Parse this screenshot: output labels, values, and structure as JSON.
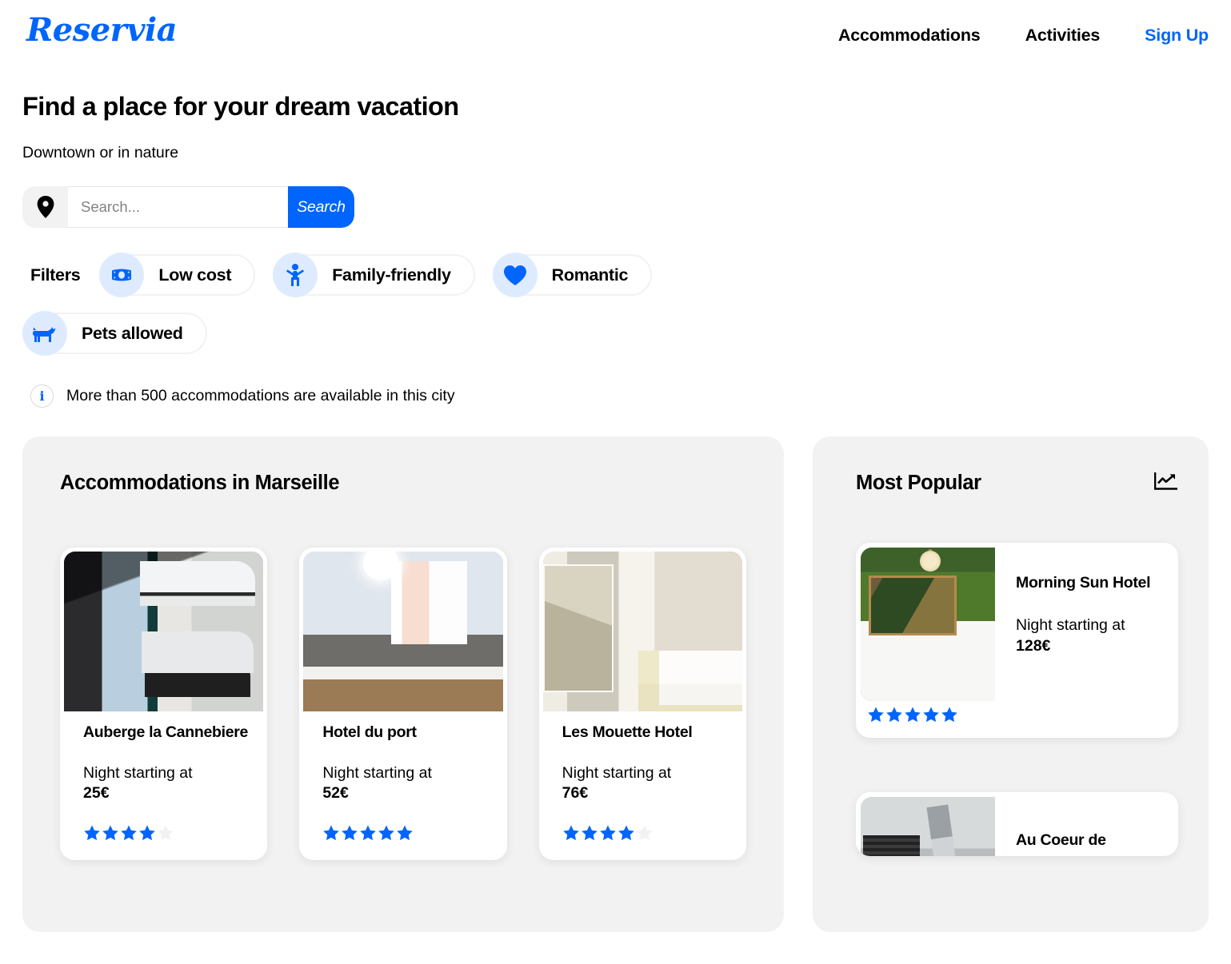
{
  "brand": {
    "name": "Reservia",
    "accent": "#0065FC",
    "accent_light": "#deebff",
    "panel_bg": "#f2f2f2",
    "star_empty": "#f2f2f2"
  },
  "nav": {
    "items": [
      {
        "label": "Accommodations",
        "name": "nav-accommodations"
      },
      {
        "label": "Activities",
        "name": "nav-activities"
      },
      {
        "label": "Sign Up",
        "name": "nav-signup"
      }
    ]
  },
  "hero": {
    "title": "Find a place for your dream vacation",
    "subtitle": "Downtown or in nature"
  },
  "search": {
    "pin_icon": "map-pin-icon",
    "placeholder": "Search...",
    "value": "",
    "button_label": "Search"
  },
  "filters": {
    "label": "Filters",
    "items": [
      {
        "label": "Low cost",
        "icon": "money-icon"
      },
      {
        "label": "Family-friendly",
        "icon": "child-icon"
      },
      {
        "label": "Romantic",
        "icon": "heart-icon"
      },
      {
        "label": "Pets allowed",
        "icon": "dog-icon"
      }
    ]
  },
  "info": {
    "icon": "info-icon",
    "text": "More than 500 accommodations are available in this city"
  },
  "accommodations_panel": {
    "title": "Accommodations in Marseille",
    "price_prefix": "Night starting at",
    "cards": [
      {
        "name": "Auberge la Cannebiere",
        "price": "25€",
        "rating": 4,
        "max_rating": 5,
        "photo": "ph-bunk"
      },
      {
        "name": "Hotel du port",
        "price": "52€",
        "rating": 5,
        "max_rating": 5,
        "photo": "ph-twin"
      },
      {
        "name": "Les Mouette Hotel",
        "price": "76€",
        "rating": 4,
        "max_rating": 5,
        "photo": "ph-mouette"
      }
    ]
  },
  "popular_panel": {
    "title": "Most Popular",
    "icon": "chart-line-up-icon",
    "price_prefix": "Night starting at",
    "cards": [
      {
        "name": "Morning Sun Hotel",
        "price": "128€",
        "rating": 5,
        "max_rating": 5,
        "photo": "ph-green"
      },
      {
        "name": "Au Coeur de",
        "price": "",
        "rating": 0,
        "max_rating": 5,
        "photo": "ph-loft"
      }
    ]
  }
}
